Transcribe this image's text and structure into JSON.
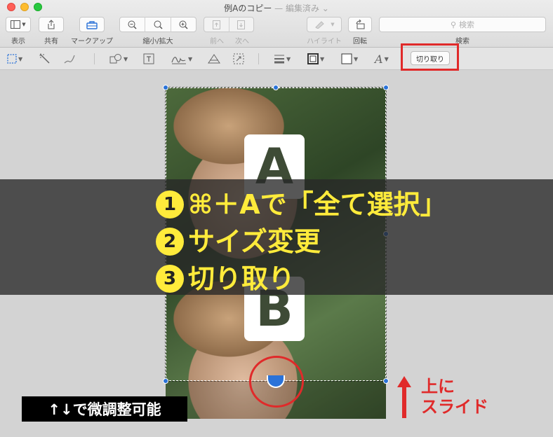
{
  "window": {
    "title": "例Aのコピー",
    "title_suffix": " — 編集済み ⌄"
  },
  "toolbar": {
    "view_label": "表示",
    "share_label": "共有",
    "markup_label": "マークアップ",
    "zoom_label": "縮小/拡大",
    "prev_label": "前へ",
    "next_label": "次へ",
    "highlight_label": "ハイライト",
    "rotate_label": "回転",
    "search_label": "検索",
    "search_placeholder": "検索"
  },
  "markup": {
    "crop_label": "切り取り"
  },
  "photo": {
    "card_a": "A",
    "card_b": "B"
  },
  "instructions": {
    "step1_num": "1",
    "step1": "⌘＋Aで「全て選択」",
    "step2_num": "2",
    "step2": "サイズ変更",
    "step3_num": "3",
    "step3": "切り取り"
  },
  "annotations": {
    "hint": "↑↓で微調整可能",
    "slide_line1": "上に",
    "slide_line2": "スライド"
  },
  "colors": {
    "highlight_red": "#e02a2a",
    "instruction_yellow": "#ffeb3b",
    "handle_blue": "#2a72d8"
  }
}
